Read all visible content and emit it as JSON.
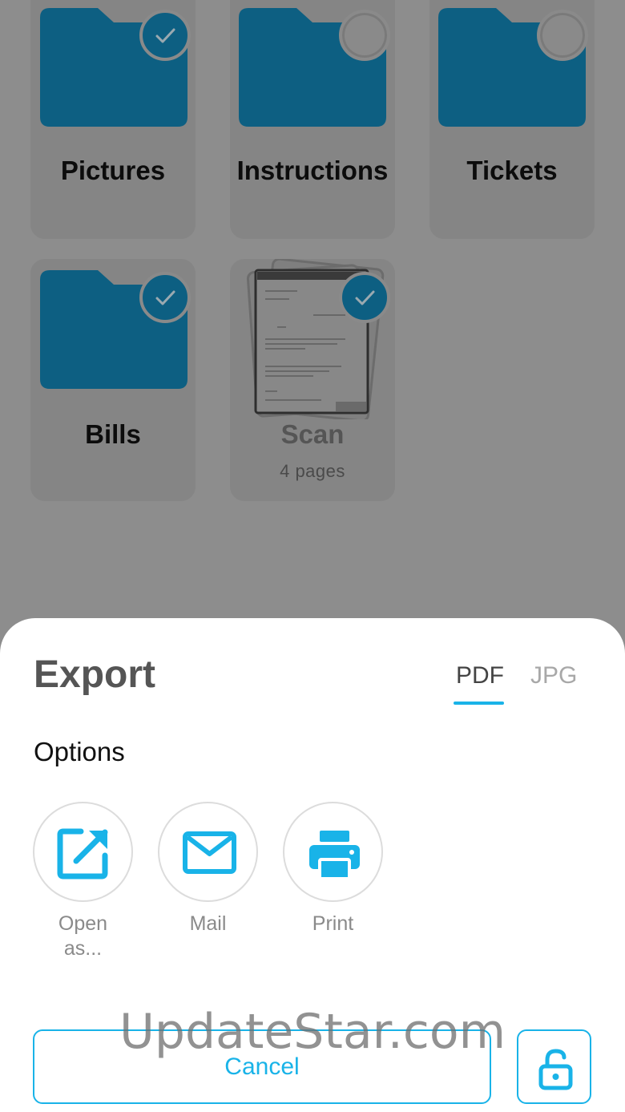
{
  "colors": {
    "accent": "#19b3e8",
    "folder": "#0d5f82",
    "dim_overlay": "#8d8d8d"
  },
  "folders": [
    {
      "name": "Pictures",
      "selected": true,
      "icon": "folder-icon"
    },
    {
      "name": "Instructions",
      "selected": false,
      "icon": "folder-icon"
    },
    {
      "name": "Tickets",
      "selected": false,
      "icon": "folder-icon"
    },
    {
      "name": "Bills",
      "selected": true,
      "icon": "folder-icon"
    }
  ],
  "document": {
    "name": "Scan",
    "pages": "4 pages",
    "selected": true,
    "icon": "document-thumbnail"
  },
  "export_sheet": {
    "title": "Export",
    "tabs": {
      "pdf": "PDF",
      "jpg": "JPG",
      "active": "PDF"
    },
    "options_heading": "Options",
    "options": [
      {
        "label": "Open as...",
        "icon": "open-external-icon"
      },
      {
        "label": "Mail",
        "icon": "mail-icon"
      },
      {
        "label": "Print",
        "icon": "printer-icon"
      }
    ],
    "cancel_label": "Cancel",
    "lock_icon": "lock-icon"
  },
  "watermark": "UpdateStar.com"
}
